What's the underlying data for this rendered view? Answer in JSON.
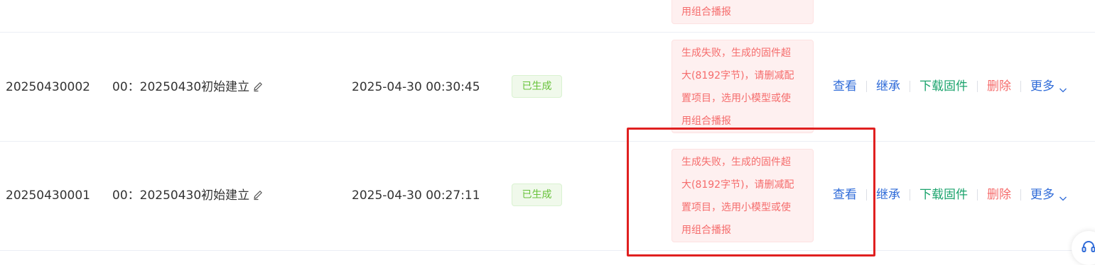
{
  "rows": [
    {
      "error_lines": [
        "用组合播报"
      ]
    },
    {
      "id": "20250430002",
      "version": "00：20250430初始建立",
      "time": "2025-04-30 00:30:45",
      "status": "已生成",
      "error_lines": [
        "生成失败，生成的固件超",
        "大(8192字节)，请删减配",
        "置项目，选用小模型或使",
        "用组合播报"
      ],
      "actions": [
        "查看",
        "继承",
        "下载固件",
        "删除",
        "更多"
      ]
    },
    {
      "id": "20250430001",
      "version": "00：20250430初始建立",
      "time": "2025-04-30 00:27:11",
      "status": "已生成",
      "error_lines": [
        "生成失败，生成的固件超",
        "大(8192字节)，请删减配",
        "置项目，选用小模型或使",
        "用组合播报"
      ],
      "actions": [
        "查看",
        "继承",
        "下载固件",
        "删除",
        "更多"
      ]
    }
  ],
  "colors": {
    "link_blue": "#2f6bd8",
    "download_green": "#1aa36c",
    "delete_red": "#f56c6c",
    "success_green": "#67c23a",
    "highlight_red": "#e02020"
  },
  "icons": {
    "edit": "edit-icon",
    "more": "chevron-down-icon",
    "support": "headset-icon"
  }
}
